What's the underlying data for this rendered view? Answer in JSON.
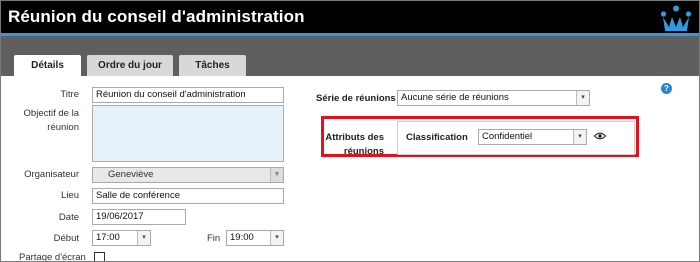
{
  "window": {
    "title": "Réunion du conseil d'administration"
  },
  "tabs": [
    {
      "label": "Détails",
      "active": true
    },
    {
      "label": "Ordre du jour",
      "active": false
    },
    {
      "label": "Tâches",
      "active": false
    }
  ],
  "form": {
    "titre": {
      "label": "Titre",
      "value": "Réunion du conseil d'administration"
    },
    "objectif": {
      "label_line1": "Objectif de la",
      "label_line2": "réunion",
      "value": ""
    },
    "organisateur": {
      "label": "Organisateur",
      "value": "Geneviève"
    },
    "lieu": {
      "label": "Lieu",
      "value": "Salle de conférence"
    },
    "date": {
      "label": "Date",
      "value": "19/06/2017"
    },
    "debut": {
      "label": "Début",
      "value": "17:00"
    },
    "fin": {
      "label": "Fin",
      "value": "19:00"
    },
    "partage": {
      "label": "Partage d'écran",
      "checked": false
    },
    "serie": {
      "label": "Série de réunions",
      "value": "Aucune série de réunions"
    },
    "attributs": {
      "label_line1": "Attributs des",
      "label_line2": "réunions",
      "classification_label": "Classification",
      "classification_value": "Confidentiel"
    }
  },
  "colors": {
    "accent": "#2e9be2",
    "highlight": "#e5101a",
    "tabbar": "#5f5f5f"
  }
}
